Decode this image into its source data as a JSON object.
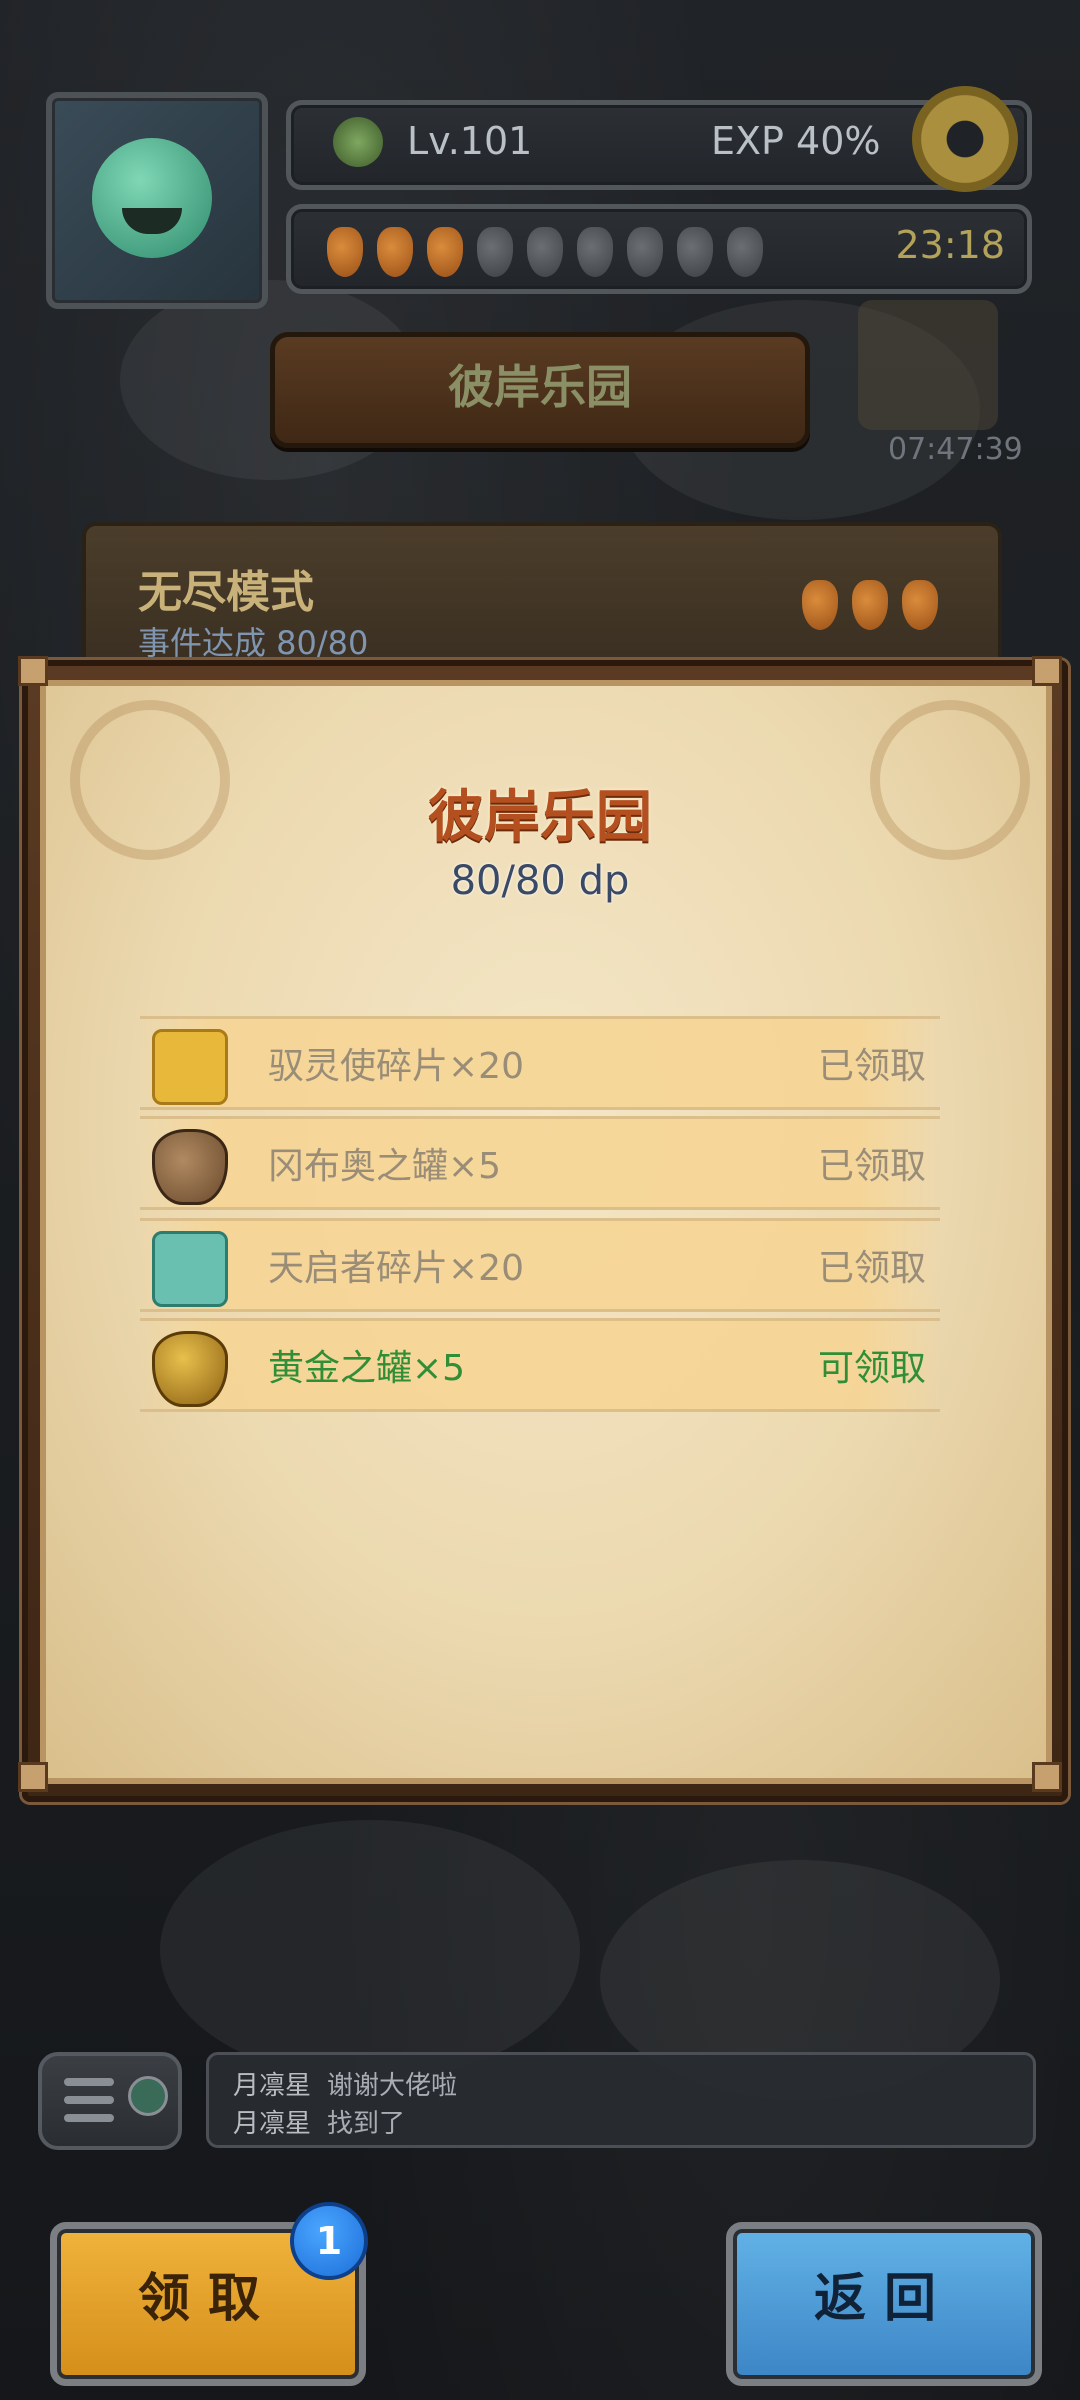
{
  "hud": {
    "level": "Lv.101",
    "exp": "EXP 40%",
    "carrots_full": 3,
    "carrots_total": 9,
    "timer": "23:18",
    "chest_timer": "07:47:39"
  },
  "area_banner": "彼岸乐园",
  "endless": {
    "title": "无尽模式",
    "progress": "事件达成 80/80"
  },
  "dialog": {
    "title": "彼岸乐园",
    "dp": "80/80 dp",
    "rewards": [
      {
        "name": "驭灵使碎片×20",
        "status": "已领取",
        "icon": "puzzle-piece-gold-icon",
        "state": "claimed"
      },
      {
        "name": "冈布奥之罐×5",
        "status": "已领取",
        "icon": "clay-pot-icon",
        "state": "claimed"
      },
      {
        "name": "天启者碎片×20",
        "status": "已领取",
        "icon": "puzzle-piece-teal-icon",
        "state": "claimed"
      },
      {
        "name": "黄金之罐×5",
        "status": "可领取",
        "icon": "golden-pot-icon",
        "state": "claimable"
      }
    ]
  },
  "chat": {
    "messages": [
      {
        "name": "月凛星",
        "text": "谢谢大佬啦"
      },
      {
        "name": "月凛星",
        "text": "找到了"
      }
    ]
  },
  "buttons": {
    "claim": "领取",
    "claim_badge": "1",
    "back": "返回"
  },
  "colors": {
    "claimed_text": "#9a8d78",
    "claimable_text": "#2f8e36",
    "dialog_title": "#b44f1f"
  }
}
